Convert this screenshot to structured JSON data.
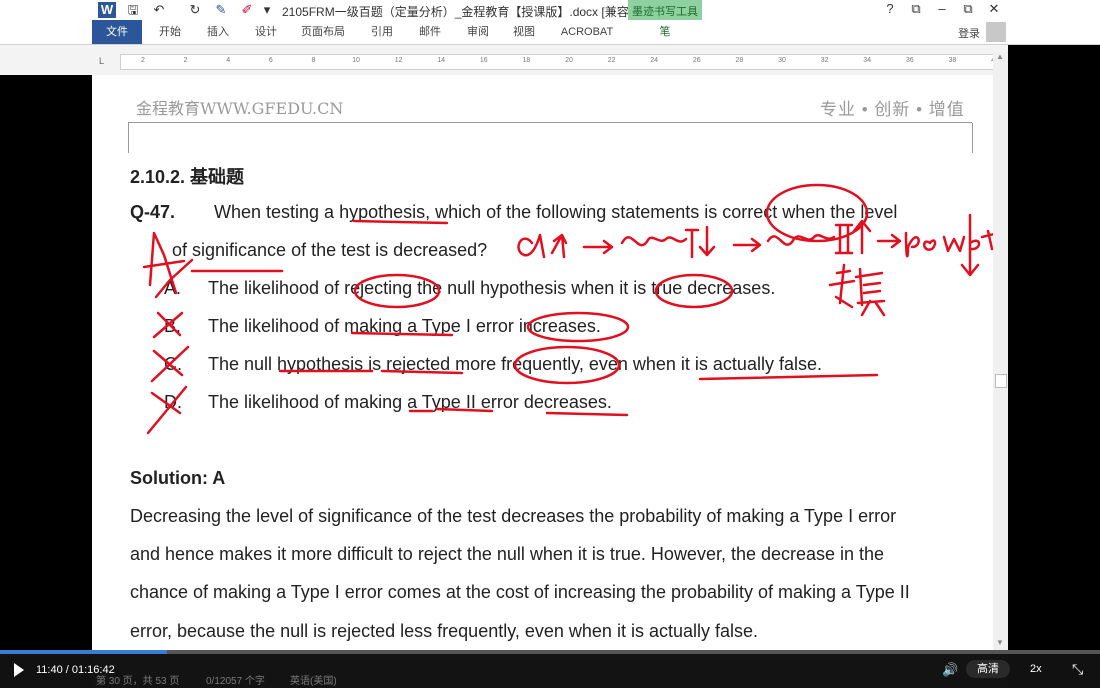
{
  "window": {
    "title": "2105FRM一级百题（定量分析）_金程教育【授课版】.docx [兼容模...",
    "ink_tools_title": "墨迹书写工具",
    "controls": [
      "?",
      "⧉",
      "–",
      "⧉",
      "✕"
    ]
  },
  "ribbon": {
    "tabs": [
      "文件",
      "开始",
      "插入",
      "设计",
      "页面布局",
      "引用",
      "邮件",
      "审阅",
      "视图",
      "ACROBAT",
      "笔"
    ],
    "login": "登录"
  },
  "ruler": {
    "ticks": [
      "2",
      "2",
      "4",
      "6",
      "8",
      "10",
      "12",
      "14",
      "16",
      "18",
      "20",
      "22",
      "24",
      "26",
      "28",
      "30",
      "32",
      "34",
      "36",
      "38",
      "40"
    ]
  },
  "document": {
    "header_left": "金程教育WWW.GFEDU.CN",
    "header_right": "专业 • 创新 • 增值",
    "section": "2.10.2.  基础题",
    "question_id": "Q-47.",
    "question_line1": "When testing a hypothesis, which of the following statements is correct when the level",
    "question_line2": "of significance of the test is decreased?",
    "options": [
      {
        "letter": "A.",
        "text": "The likelihood of rejecting the null hypothesis when it is true decreases."
      },
      {
        "letter": "B.",
        "text": "The likelihood of making a Type I error increases."
      },
      {
        "letter": "C.",
        "text": "The null hypothesis is rejected more frequently, even when it is actually false."
      },
      {
        "letter": "D.",
        "text": "The likelihood of making a Type II error decreases."
      }
    ],
    "solution_title": "Solution: A",
    "solution_lines": [
      "Decreasing the level of significance of the test decreases the probability of making a Type I error",
      "and hence makes it more difficult to reject the null when it is true. However, the decrease in the",
      "chance of making a Type I error comes at the cost of increasing the probability of making a Type II",
      "error, because the null is rejected less frequently, even when it is actually false."
    ]
  },
  "annotations": {
    "ink_color": "#e01020",
    "handwriting": "α↓ → type I↓ → type II↑ → power↓",
    "chinese_note": "错误"
  },
  "statusbar": {
    "page": "第 30 页，共 53 页",
    "words": "0/12057 个字",
    "language": "英语(美国)"
  },
  "player": {
    "time": "11:40 / 01:16:42",
    "quality": "高清",
    "speed": "2x",
    "progress": 0.152
  }
}
